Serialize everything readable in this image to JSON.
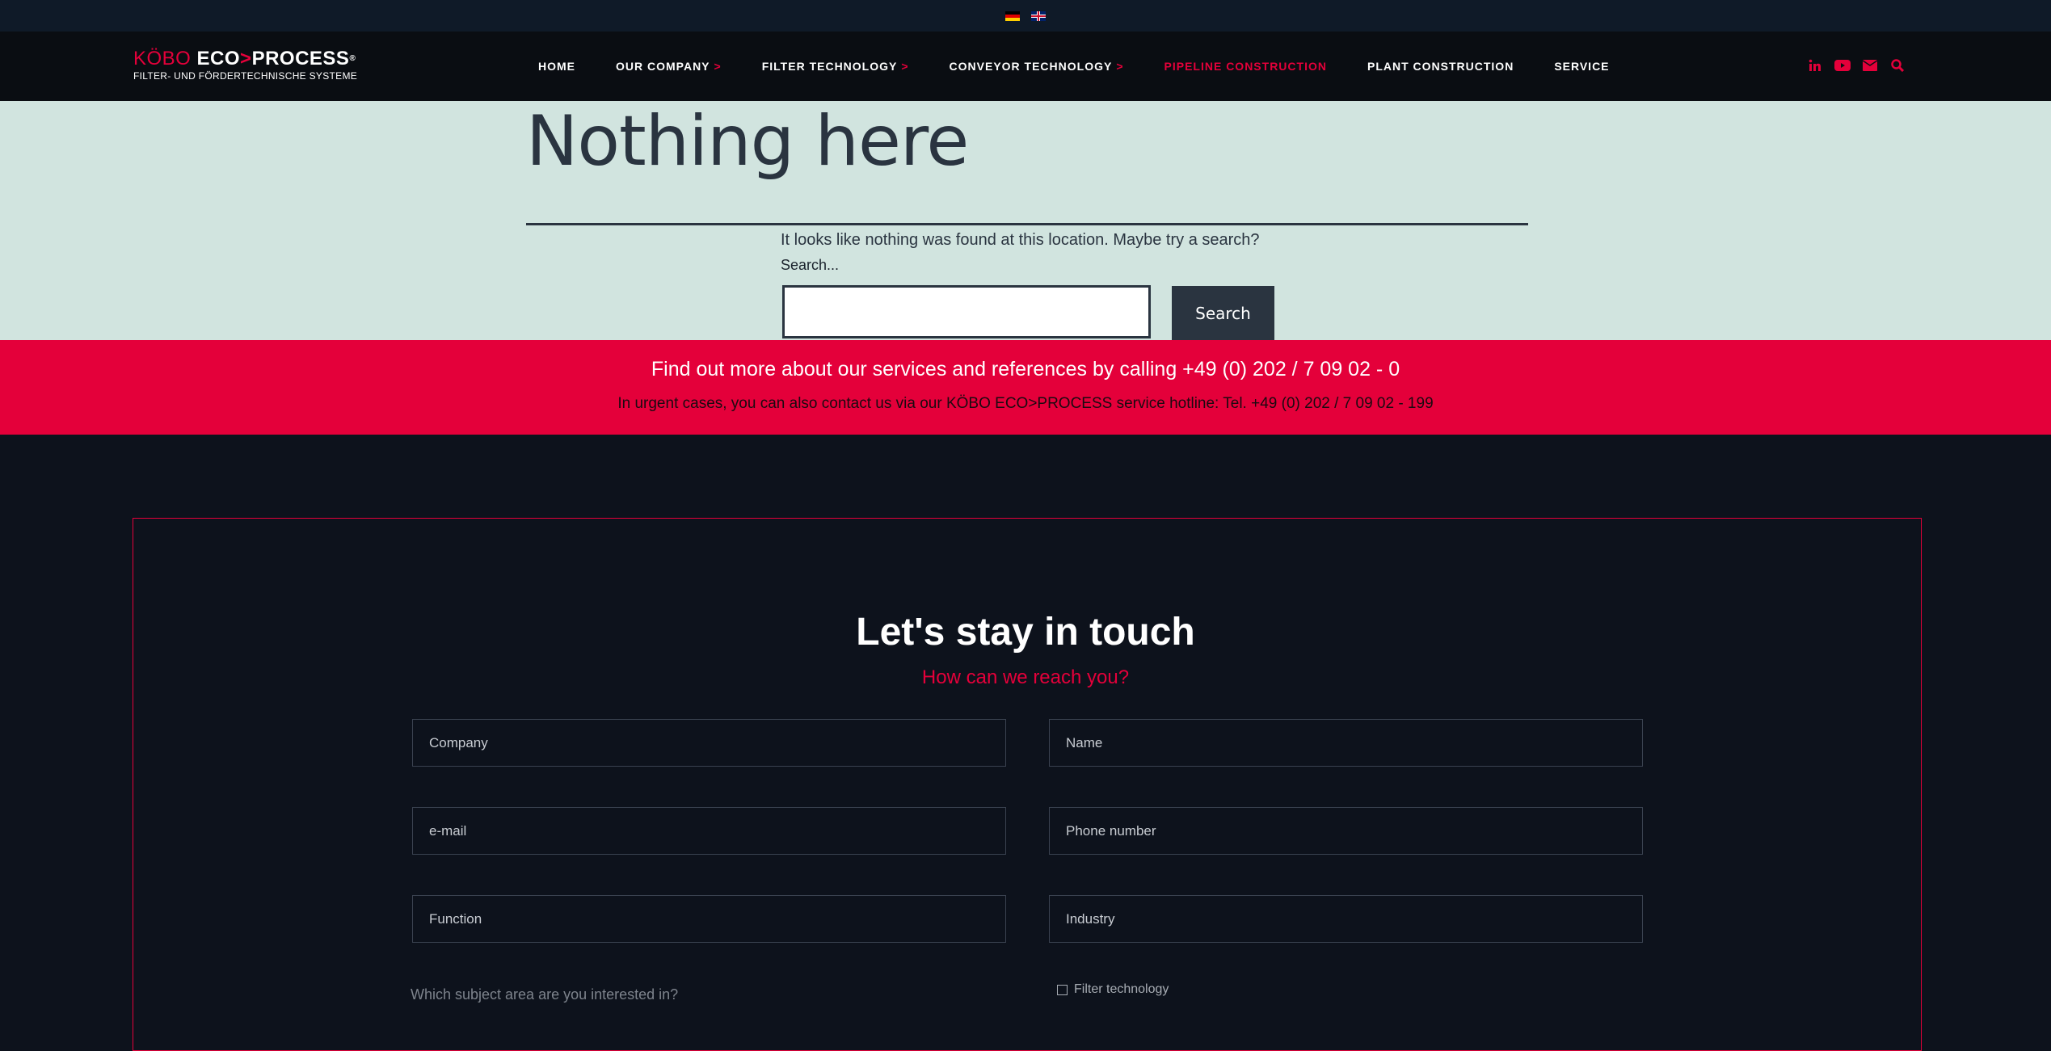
{
  "language_bar": {
    "languages": [
      {
        "code": "de",
        "icon": "german-flag-icon"
      },
      {
        "code": "en",
        "icon": "uk-flag-icon"
      }
    ]
  },
  "header": {
    "logo": {
      "kobo": "KÖBO",
      "eco": "ECO",
      "arrow": ">",
      "process": "PROCESS",
      "registered": "®",
      "tagline": "FILTER- UND FÖRDERTECHNISCHE SYSTEME"
    },
    "nav": [
      {
        "label": "HOME",
        "has_submenu": false,
        "active": false
      },
      {
        "label": "OUR COMPANY",
        "has_submenu": true,
        "active": false
      },
      {
        "label": "FILTER TECHNOLOGY",
        "has_submenu": true,
        "active": false
      },
      {
        "label": "CONVEYOR TECHNOLOGY",
        "has_submenu": true,
        "active": false
      },
      {
        "label": "PIPELINE CONSTRUCTION",
        "has_submenu": false,
        "active": true
      },
      {
        "label": "PLANT CONSTRUCTION",
        "has_submenu": false,
        "active": false
      },
      {
        "label": "SERVICE",
        "has_submenu": false,
        "active": false
      }
    ],
    "submenu_chevron": ">",
    "social_icons": [
      "linkedin-icon",
      "youtube-icon",
      "email-icon",
      "search-icon"
    ]
  },
  "not_found": {
    "title": "Nothing here",
    "message": "It looks like nothing was found at this location. Maybe try a search?",
    "search_label": "Search...",
    "search_value": "",
    "search_button": "Search"
  },
  "banner": {
    "main": "Find out more about our services and references by calling +49 (0) 202 / 7 09 02 - 0",
    "sub": "In urgent cases, you can also contact us via our KÖBO ECO>PROCESS service hotline: Tel. +49 (0) 202 / 7 09 02 - 199"
  },
  "contact": {
    "title": "Let's stay in touch",
    "subtitle": "How can we reach you?",
    "fields": {
      "company": "Company",
      "name": "Name",
      "email": "e-mail",
      "phone": "Phone number",
      "function": "Function",
      "industry": "Industry"
    },
    "subject_question": "Which subject area are you interested in?",
    "subject_options": [
      "Filter technology"
    ]
  },
  "colors": {
    "accent": "#e4003a",
    "dark_bg": "#0d121c",
    "header_bg": "#0a0d12",
    "hero_bg": "#d1e4df",
    "text_dark": "#2a3440"
  }
}
